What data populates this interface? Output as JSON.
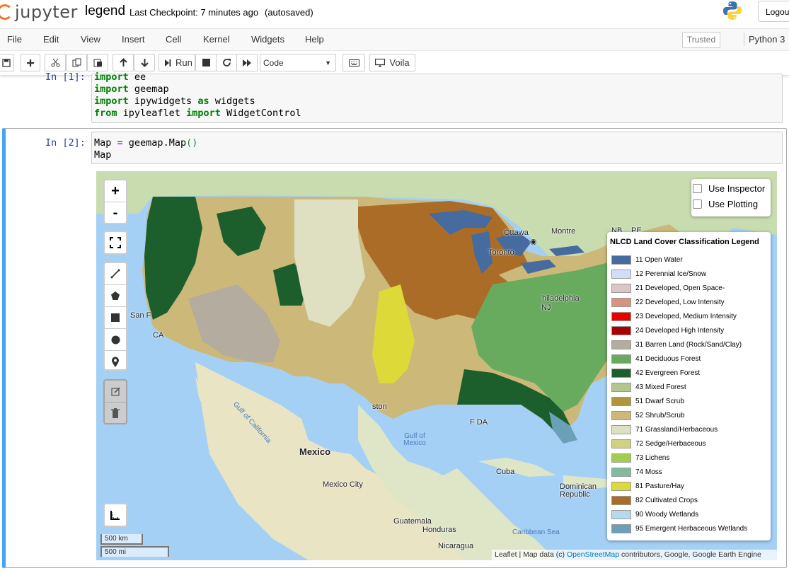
{
  "header": {
    "logo_text": "jupyter",
    "notebook_name": "legend",
    "checkpoint": "Last Checkpoint: 7 minutes ago",
    "autosave": "(autosaved)",
    "logout": "Logout"
  },
  "menu": {
    "items": [
      "File",
      "Edit",
      "View",
      "Insert",
      "Cell",
      "Kernel",
      "Widgets",
      "Help"
    ],
    "trusted": "Trusted",
    "kernel": "Python 3"
  },
  "toolbar": {
    "run_label": "Run",
    "cell_type": "Code",
    "voila_label": "Voila"
  },
  "cells": [
    {
      "prompt": "In [1]:",
      "lines": [
        "import ee",
        "import geemap",
        "import ipywidgets as widgets",
        "from ipyleaflet import WidgetControl"
      ]
    },
    {
      "prompt": "In [2]:",
      "lines": [
        "Map = geemap.Map()",
        "Map"
      ]
    }
  ],
  "map": {
    "zoom_in": "+",
    "zoom_out": "-",
    "inspector": {
      "use_inspector": "Use Inspector",
      "use_plotting": "Use Plotting"
    },
    "places": {
      "ottawa": "Ottawa",
      "montreal": "Montre",
      "toronto": "Toronto",
      "philadelphia": "hiladelphia",
      "nj": "NJ",
      "san_fran": "San F",
      "ca": "CA",
      "houston": "ston",
      "fl": "F  DA",
      "mexico": "Mexico",
      "mexico_city": "Mexico City",
      "cuba": "Cuba",
      "dominican": "Dominican Republic",
      "guatemala": "Guatemala",
      "honduras": "Honduras",
      "nicaragua": "Nicaragua",
      "gulf_california": "Gulf of California",
      "gulf_mexico": "Gulf of Mexico",
      "caribbean": "Caribbean Sea",
      "nb": "NB",
      "pe": "PE"
    },
    "scale": {
      "km": "500 km",
      "mi": "500 mi"
    },
    "attribution_prefix": "Leaflet | Map data (c) ",
    "attribution_link": "OpenStreetMap",
    "attribution_suffix": " contributors, Google, Google Earth Engine"
  },
  "legend": {
    "title": "NLCD Land Cover Classification Legend",
    "items": [
      {
        "label": "11 Open Water",
        "color": "#466b9f"
      },
      {
        "label": "12 Perennial Ice/Snow",
        "color": "#d1def8"
      },
      {
        "label": "21 Developed, Open Space-",
        "color": "#dec5c5"
      },
      {
        "label": "22 Developed, Low Intensity",
        "color": "#d99282"
      },
      {
        "label": "23 Developed, Medium Intensity",
        "color": "#eb0000"
      },
      {
        "label": "24 Developed High Intensity",
        "color": "#ab0000"
      },
      {
        "label": "31 Barren Land (Rock/Sand/Clay)",
        "color": "#b3ac9f"
      },
      {
        "label": "41 Deciduous Forest",
        "color": "#68ab5f"
      },
      {
        "label": "42 Evergreen Forest",
        "color": "#1c5f2c"
      },
      {
        "label": "43 Mixed Forest",
        "color": "#b5c58f"
      },
      {
        "label": "51 Dwarf Scrub",
        "color": "#af963c"
      },
      {
        "label": "52 Shrub/Scrub",
        "color": "#ccb879"
      },
      {
        "label": "71 Grassland/Herbaceous",
        "color": "#dfdfc2"
      },
      {
        "label": "72 Sedge/Herbaceous",
        "color": "#d1d182"
      },
      {
        "label": "73 Lichens",
        "color": "#a3cc51"
      },
      {
        "label": "74 Moss",
        "color": "#82ba9e"
      },
      {
        "label": "81 Pasture/Hay",
        "color": "#dcd939"
      },
      {
        "label": "82 Cultivated Crops",
        "color": "#ab6c28"
      },
      {
        "label": "90 Woody Wetlands",
        "color": "#b8d9eb"
      },
      {
        "label": "95 Emergent Herbaceous Wetlands",
        "color": "#6c9fb8"
      }
    ]
  }
}
